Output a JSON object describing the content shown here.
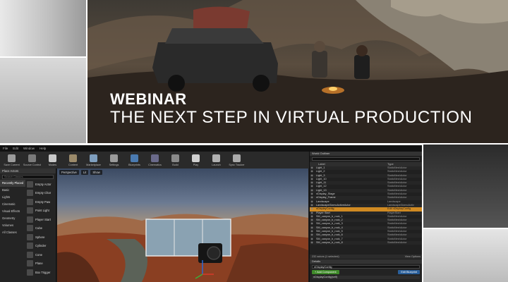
{
  "banner": {
    "kicker": "WEBINAR",
    "title": "THE NEXT STEP IN VIRTUAL PRODUCTION"
  },
  "editor": {
    "menu": [
      "File",
      "Edit",
      "Window",
      "Help"
    ],
    "toolbar": [
      {
        "label": "Save Current",
        "icon": "save-icon",
        "color": "#9b9b9b"
      },
      {
        "label": "Source Control",
        "icon": "source-control-icon",
        "color": "#7a7a7a"
      },
      {
        "label": "Modes",
        "icon": "modes-icon",
        "color": "#c9c9c9"
      },
      {
        "label": "Content",
        "icon": "content-icon",
        "color": "#9b8a6a"
      },
      {
        "label": "Marketplace",
        "icon": "marketplace-icon",
        "color": "#7f9fbf"
      },
      {
        "label": "Settings",
        "icon": "settings-icon",
        "color": "#9a9a9a"
      },
      {
        "label": "Blueprints",
        "icon": "blueprints-icon",
        "color": "#4a7ab0"
      },
      {
        "label": "Cinematics",
        "icon": "cinematics-icon",
        "color": "#6a6a8a"
      },
      {
        "label": "Build",
        "icon": "build-icon",
        "color": "#8a8a8a"
      },
      {
        "label": "Play",
        "icon": "play-icon",
        "color": "#d0d0d0"
      },
      {
        "label": "Launch",
        "icon": "launch-icon",
        "color": "#b0b0b0"
      },
      {
        "label": "Sync Tracker",
        "icon": "sync-tracker-icon",
        "color": "#aaaaaa"
      }
    ],
    "modes": {
      "tab": "Place Actors",
      "search_placeholder": "Search Classes",
      "categories": [
        "Recently Placed",
        "Basic",
        "Lights",
        "Cinematic",
        "Visual Effects",
        "Geometry",
        "Volumes",
        "All Classes"
      ],
      "selected_category": "Recently Placed",
      "items": [
        "Empty Actor",
        "Empty Char",
        "Empty Paw",
        "Point Light",
        "Player Start",
        "Cube",
        "Sphere",
        "Cylinder",
        "Cone",
        "Plane",
        "Box Trigger"
      ]
    },
    "viewport": {
      "buttons": [
        "Perspective",
        "Lit",
        "Show"
      ]
    },
    "outliner": {
      "tab": "World Outliner",
      "columns": [
        "Label",
        "Type"
      ],
      "rows": [
        {
          "label": "Light_1",
          "type": "StaticMeshActor"
        },
        {
          "label": "Light_2",
          "type": "StaticMeshActor"
        },
        {
          "label": "Light_3",
          "type": "StaticMeshActor"
        },
        {
          "label": "Light_10",
          "type": "StaticMeshActor"
        },
        {
          "label": "Light_11",
          "type": "StaticMeshActor"
        },
        {
          "label": "Light_12",
          "type": "StaticMeshActor"
        },
        {
          "label": "Light_13",
          "type": "StaticMeshActor"
        },
        {
          "label": "nDisplay_Stage",
          "type": "StaticMeshActor"
        },
        {
          "label": "nDisplay_Frame",
          "type": "StaticMeshActor"
        },
        {
          "label": "Landscape",
          "type": "Landscape"
        },
        {
          "label": "LandscapeGizmoActiveActor",
          "type": "LandscapeGizmoActiv"
        },
        {
          "label": "nDisplayConfig",
          "type": "Edit nDisplayConfig",
          "selected": true
        },
        {
          "label": "Player Start",
          "type": "PlayerStart"
        },
        {
          "label": "SM_canyon_b_rock_1",
          "type": "StaticMeshActor"
        },
        {
          "label": "SM_canyon_b_rock_2",
          "type": "StaticMeshActor"
        },
        {
          "label": "SM_canyon_b_rock_3",
          "type": "StaticMeshActor"
        },
        {
          "label": "SM_canyon_b_rock_4",
          "type": "StaticMeshActor"
        },
        {
          "label": "SM_canyon_b_rock_5",
          "type": "StaticMeshActor"
        },
        {
          "label": "SM_canyon_b_rock_6",
          "type": "StaticMeshActor"
        },
        {
          "label": "SM_canyon_b_rock_7",
          "type": "StaticMeshActor"
        },
        {
          "label": "SM_canyon_b_rock_8",
          "type": "StaticMeshActor"
        }
      ],
      "status": "232 actors (1 selected)",
      "view_options": "View Options"
    },
    "details": {
      "tab": "Details",
      "name_value": "nDisplayConfig",
      "add_component": "+ Add Component",
      "edit_blueprint": "Edit Blueprint",
      "search_row": "nDisplayConfig(self)"
    }
  }
}
